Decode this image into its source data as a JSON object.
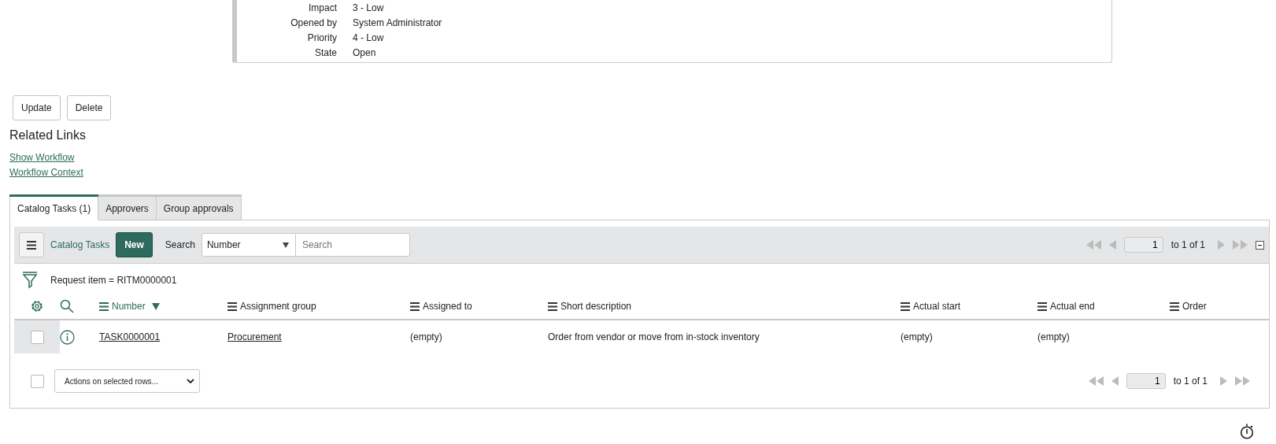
{
  "record": {
    "fields": [
      {
        "label": "Impact",
        "value": "3 - Low"
      },
      {
        "label": "Opened by",
        "value": "System Administrator"
      },
      {
        "label": "Priority",
        "value": "4 - Low"
      },
      {
        "label": "State",
        "value": "Open"
      }
    ]
  },
  "buttons": [
    "Update",
    "Delete"
  ],
  "related_links": {
    "title": "Related Links",
    "links": [
      "Show Workflow",
      "Workflow Context"
    ]
  },
  "tabs": [
    {
      "label": "Catalog Tasks (1)",
      "selected": true
    },
    {
      "label": "Approvers",
      "selected": false
    },
    {
      "label": "Group approvals",
      "selected": false
    }
  ],
  "list": {
    "title": "Catalog Tasks",
    "new_button": "New",
    "search_label": "Search",
    "search_column": "Number",
    "search_placeholder": "Search",
    "pager": {
      "page": "1",
      "range": "to 1 of 1"
    },
    "filter": "Request item = RITM0000001",
    "columns": [
      {
        "label": "Number",
        "sorted": true
      },
      {
        "label": "Assignment group",
        "sorted": false
      },
      {
        "label": "Assigned to",
        "sorted": false
      },
      {
        "label": "Short description",
        "sorted": false
      },
      {
        "label": "Actual start",
        "sorted": false
      },
      {
        "label": "Actual end",
        "sorted": false
      },
      {
        "label": "Order",
        "sorted": false
      }
    ],
    "rows": [
      {
        "checked": false,
        "cells": [
          {
            "kind": "link",
            "text": "TASK0000001"
          },
          {
            "kind": "link",
            "text": "Procurement"
          },
          {
            "kind": "text",
            "text": "(empty)"
          },
          {
            "kind": "text",
            "text": "Order from vendor or move from in-stock inventory"
          },
          {
            "kind": "text",
            "text": "(empty)"
          },
          {
            "kind": "text",
            "text": "(empty)"
          }
        ]
      }
    ],
    "select_all_checked": false,
    "actions_placeholder": "Actions on selected rows...",
    "footer_pager": {
      "page": "1",
      "range": "to 1 of 1"
    }
  }
}
